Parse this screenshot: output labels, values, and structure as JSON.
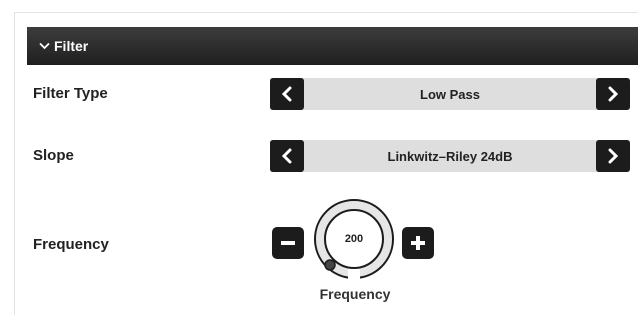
{
  "panel": {
    "title": "Filter",
    "chevron_icon": "chevron-down-icon"
  },
  "filter_type": {
    "label": "Filter Type",
    "value": "Low Pass",
    "prev_icon": "chevron-left-icon",
    "next_icon": "chevron-right-icon"
  },
  "slope": {
    "label": "Slope",
    "value": "Linkwitz–Riley 24dB",
    "prev_icon": "chevron-left-icon",
    "next_icon": "chevron-right-icon"
  },
  "frequency": {
    "label": "Frequency",
    "knob_value": "200",
    "knob_caption": "Frequency",
    "decrease_icon": "minus-icon",
    "increase_icon": "plus-icon"
  },
  "colors": {
    "header_bg": "#2a2a2a",
    "button_bg": "#1c1c1c",
    "selector_bg": "#dedede",
    "knob_ring": "#1c1c1c"
  }
}
